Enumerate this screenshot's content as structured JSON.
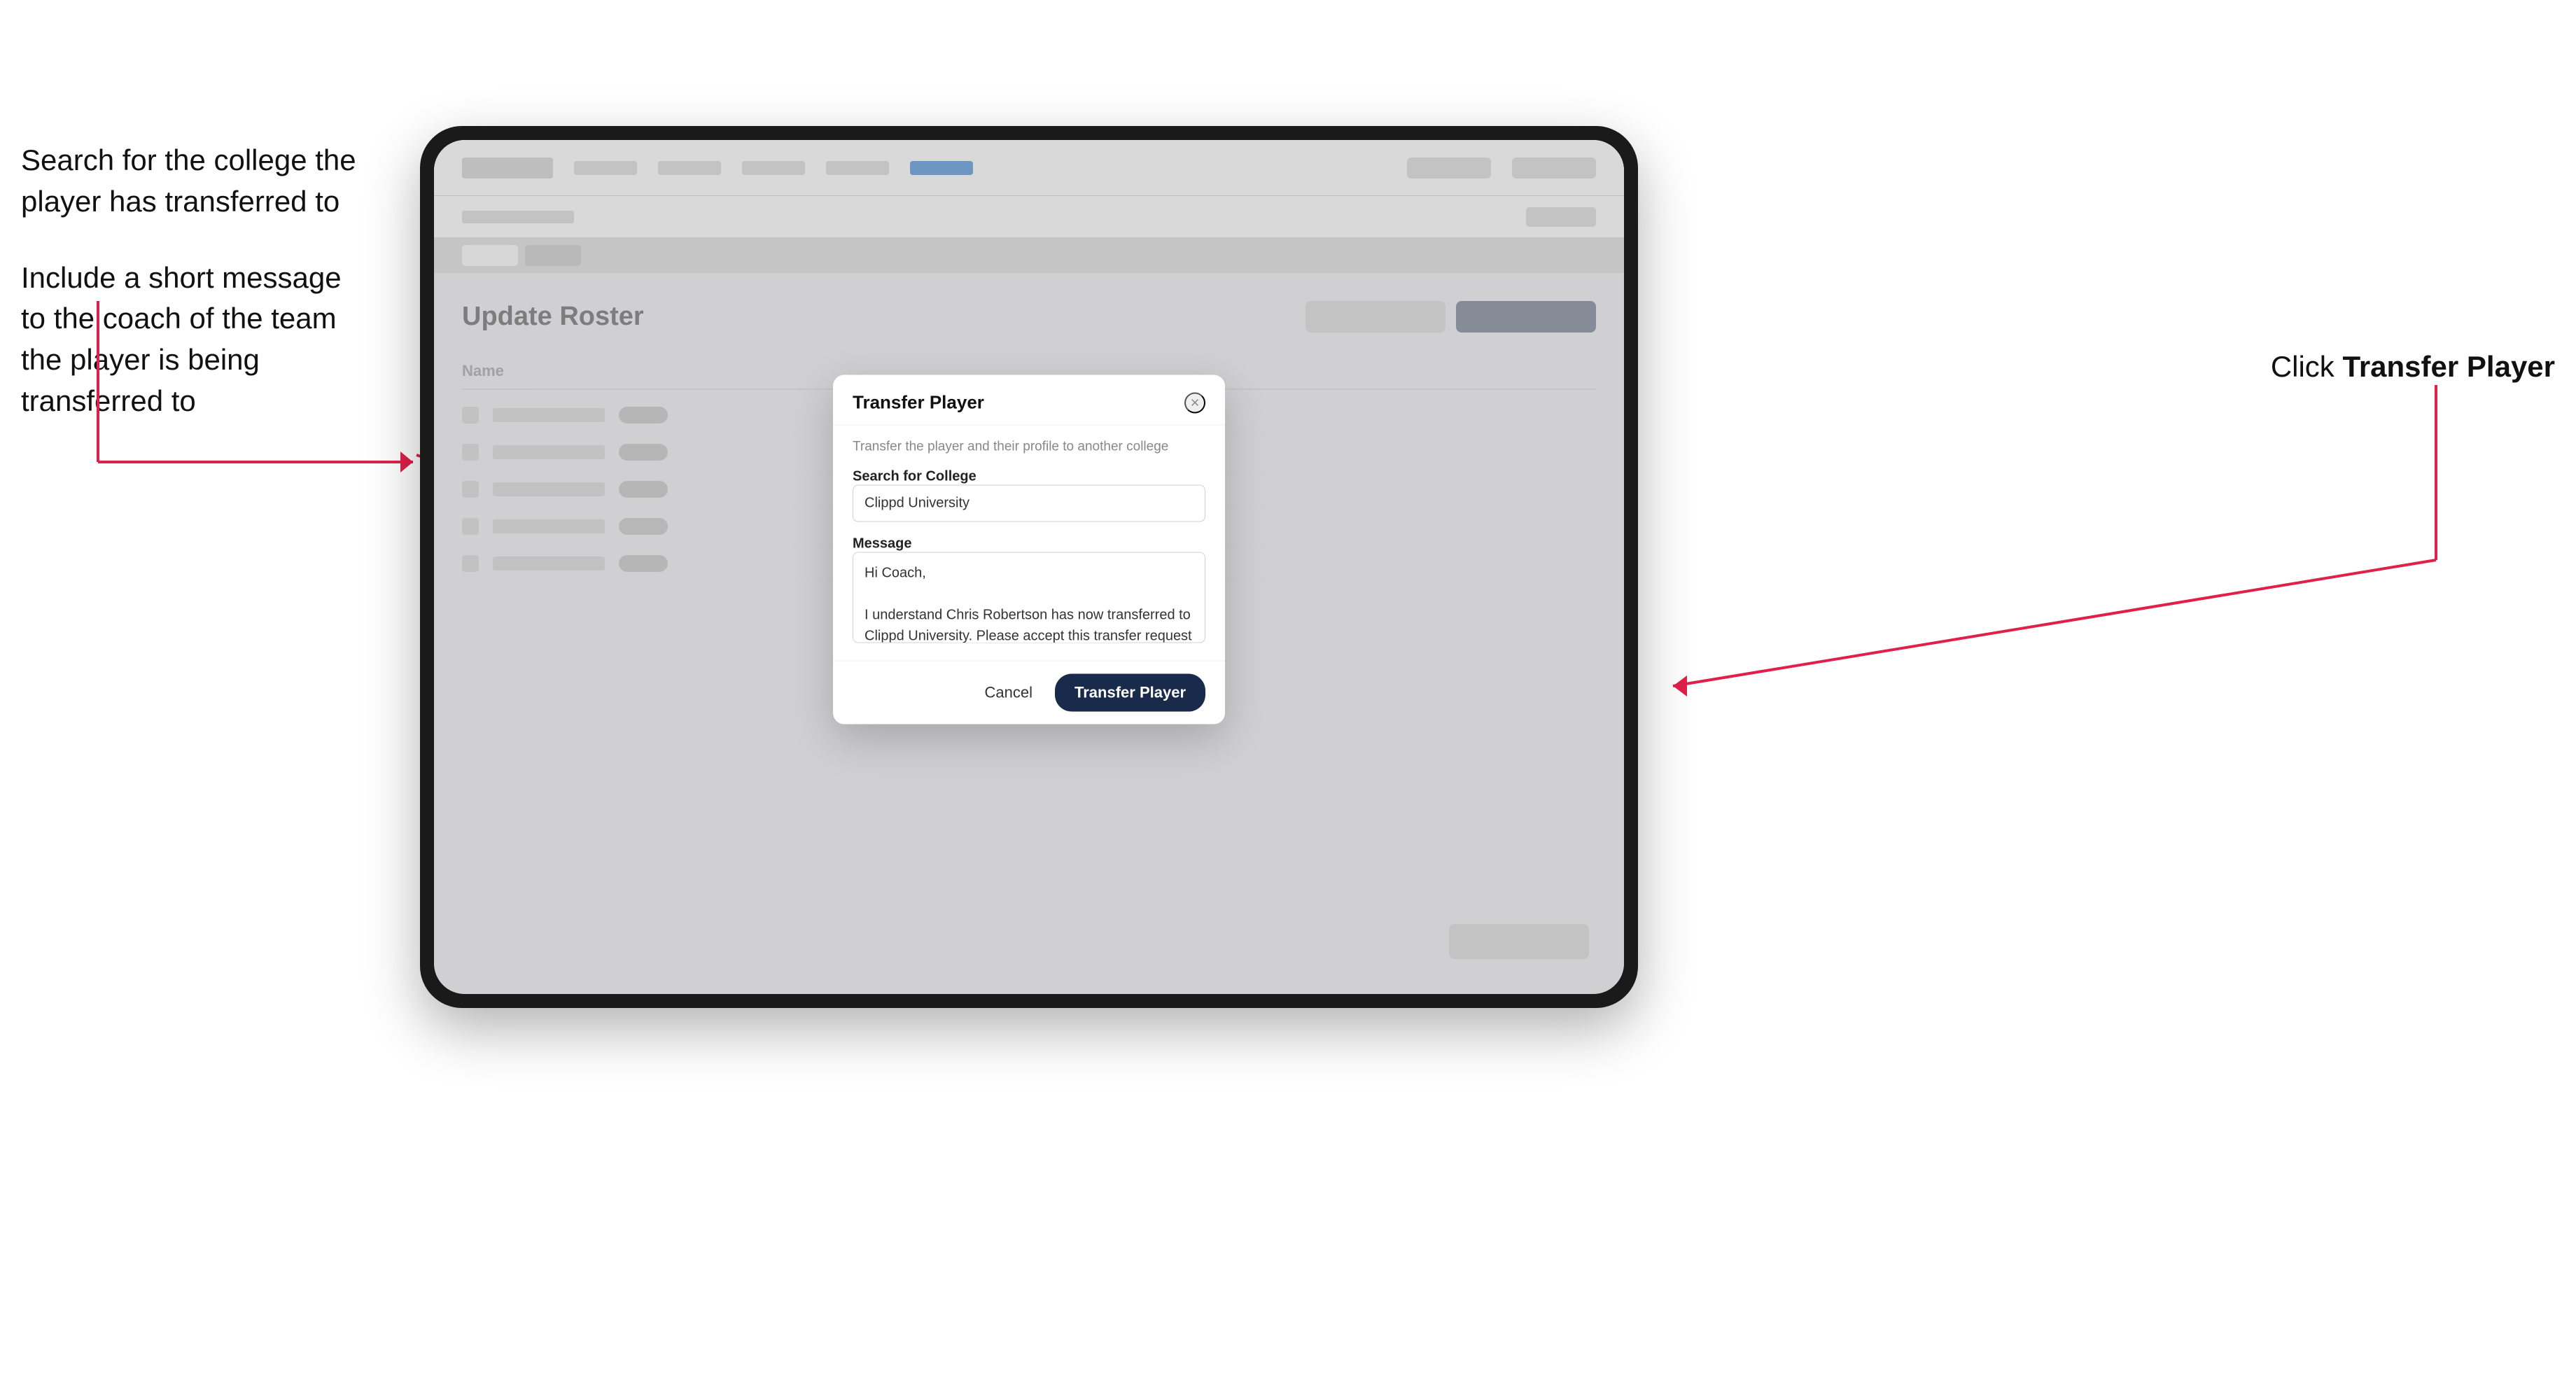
{
  "annotations": {
    "left_top": "Search for the college the player has transferred to",
    "left_bottom": "Include a short message to the coach of the team the player is being transferred to",
    "right": "Click Transfer Player"
  },
  "modal": {
    "title": "Transfer Player",
    "description": "Transfer the player and their profile to another college",
    "search_label": "Search for College",
    "search_value": "Clippd University",
    "message_label": "Message",
    "message_value": "Hi Coach,\n\nI understand Chris Robertson has now transferred to Clippd University. Please accept this transfer request when you can.",
    "cancel_label": "Cancel",
    "transfer_label": "Transfer Player",
    "close_icon": "×"
  },
  "page": {
    "title": "Update Roster"
  }
}
